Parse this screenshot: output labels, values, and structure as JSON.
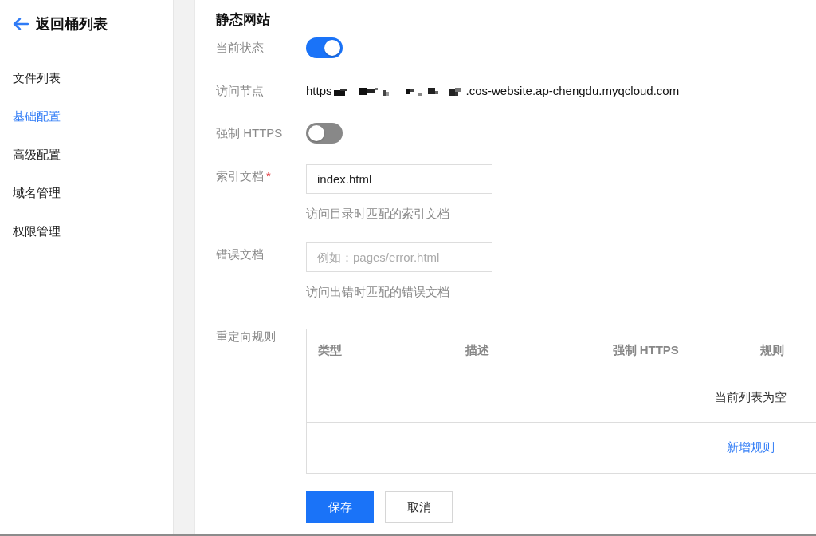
{
  "sidebar": {
    "back": {
      "label": "返回桶列表"
    },
    "items": [
      {
        "label": "文件列表",
        "selected": false
      },
      {
        "label": "基础配置",
        "selected": true
      },
      {
        "label": "高级配置",
        "selected": false
      },
      {
        "label": "域名管理",
        "selected": false
      },
      {
        "label": "权限管理",
        "selected": false
      }
    ]
  },
  "section": {
    "title": "静态网站",
    "fields": [
      {
        "kind": "switch",
        "label": "当前状态",
        "on": true
      },
      {
        "kind": "endpoint",
        "label": "访问节点",
        "prefix": "https",
        "redacted": true,
        "suffix": ".cos-website.ap-chengdu.myqcloud.com"
      },
      {
        "kind": "switch",
        "label": "强制 HTTPS",
        "on": false
      },
      {
        "kind": "input",
        "label": "索引文档",
        "required_mark": "*",
        "value": "index.html",
        "help": "访问目录时匹配的索引文档"
      },
      {
        "kind": "input",
        "label": "错误文档",
        "placeholder": "例如：pages/error.html",
        "help": "访问出错时匹配的错误文档"
      },
      {
        "kind": "table",
        "label": "重定向规则",
        "columns": [
          "类型",
          "描述",
          "强制 HTTPS",
          "规则"
        ],
        "empty_text": "当前列表为空",
        "add_link": "新增规则"
      }
    ]
  },
  "buttons": [
    {
      "kind": "primary",
      "label": "保存"
    },
    {
      "kind": "default",
      "label": "取消"
    }
  ]
}
